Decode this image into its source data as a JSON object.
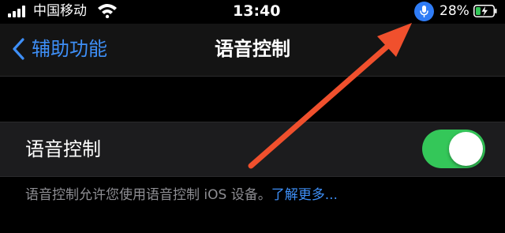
{
  "status_bar": {
    "carrier": "中国移动",
    "time": "13:40",
    "battery_percent": "28%",
    "battery_level": 0.28,
    "icons": [
      "signal-icon",
      "wifi-icon",
      "microphone-icon",
      "battery-charging-icon"
    ]
  },
  "nav": {
    "back_label": "辅助功能",
    "title": "语音控制"
  },
  "settings": {
    "voice_control": {
      "label": "语音控制",
      "enabled": true
    },
    "footer": {
      "text": "语音控制允许您使用语音控制 iOS 设备。",
      "link": "了解更多..."
    }
  },
  "colors": {
    "accent_blue": "#3e8ff7",
    "toggle_on": "#34c759",
    "mic_indicator": "#2f7cf6",
    "annotation_arrow": "#f0502d",
    "background": "#000000",
    "cell_background": "#1c1c1e"
  }
}
